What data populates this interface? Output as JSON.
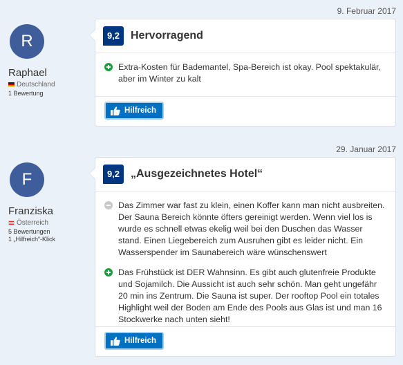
{
  "reviews": [
    {
      "date": "9. Februar 2017",
      "reviewer": {
        "initial": "R",
        "name": "Raphael",
        "country": "Deutschland",
        "meta": [
          "1 Bewertung"
        ]
      },
      "score": "9,2",
      "title": "Hervorragend",
      "negative": "",
      "positive": "Extra-Kosten für Bademantel, Spa-Bereich ist okay. Pool spektakulär, aber im Winter zu kalt",
      "helpful_label": "Hilfreich"
    },
    {
      "date": "29. Januar 2017",
      "reviewer": {
        "initial": "F",
        "name": "Franziska",
        "country": "Österreich",
        "meta": [
          "5 Bewertungen",
          "1 „Hilfreich“-Klick"
        ]
      },
      "score": "9,2",
      "title": "„Ausgezeichnetes Hotel“",
      "negative": "Das Zimmer war fast zu klein, einen Koffer kann man nicht ausbreiten. Der Sauna Bereich könnte öfters gereinigt werden. Wenn viel los is wurde es schnell etwas ekelig weil bei den Duschen das Wasser stand. Einen Liegebereich zum Ausruhen gibt es leider nicht. Ein Wasserspender  im Saunabereich wäre wünschenswert",
      "positive": "Das Frühstück ist DER Wahnsinn.  Es gibt auch glutenfreie Produkte und Sojamilch. Die Aussicht ist auch sehr schön. Man geht ungefähr 20 min ins Zentrum. Die Sauna ist super. Der rooftop Pool ein totales Highlight weil der Boden am Ende des Pools aus Glas ist und man 16 Stockwerke nach unten sieht!",
      "helpful_label": "Hilfreich"
    }
  ],
  "icons": {
    "positive": "plus-circle-icon",
    "negative": "minus-circle-icon",
    "helpful": "thumbs-up-icon"
  },
  "colors": {
    "score_bg": "#003580",
    "button_bg": "#0071c2",
    "positive": "#1e9d3e",
    "negative": "#c8c8c8",
    "avatar_bg": "#3f5d9b",
    "page_bg": "#eaf1f8"
  }
}
